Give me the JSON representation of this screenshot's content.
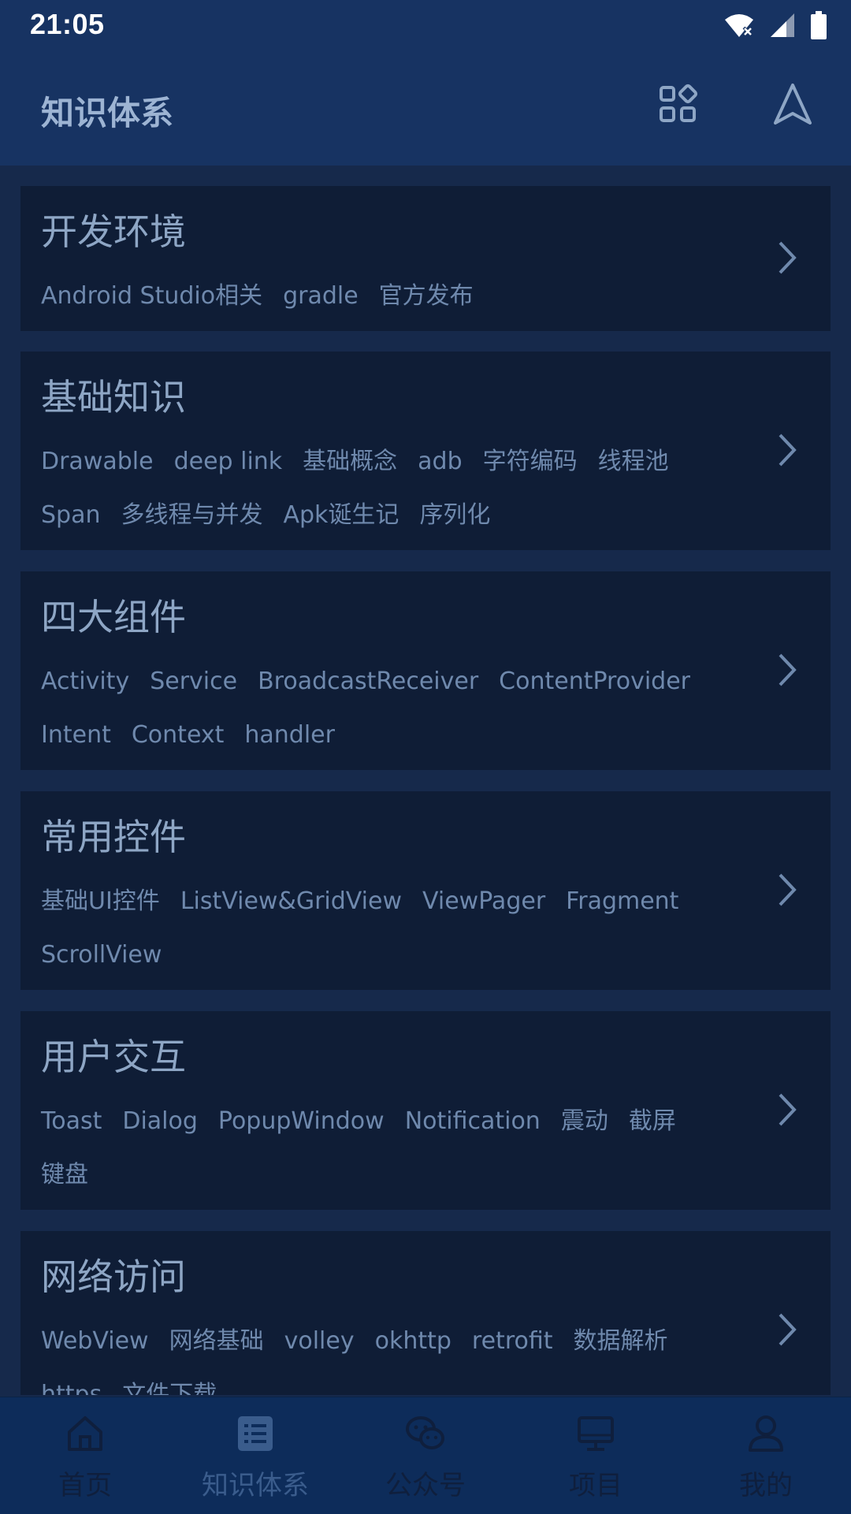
{
  "status": {
    "time": "21:05"
  },
  "appbar": {
    "title": "知识体系",
    "apps_icon": "apps-grid-icon",
    "navigate_icon": "navigation-arrow-icon"
  },
  "categories": [
    {
      "title": "开发环境",
      "tags": [
        "Android Studio相关",
        "gradle",
        "官方发布"
      ]
    },
    {
      "title": "基础知识",
      "tags": [
        "Drawable",
        "deep link",
        "基础概念",
        "adb",
        "字符编码",
        "线程池",
        "Span",
        "多线程与并发",
        "Apk诞生记",
        "序列化"
      ]
    },
    {
      "title": "四大组件",
      "tags": [
        "Activity",
        "Service",
        "BroadcastReceiver",
        "ContentProvider",
        "Intent",
        "Context",
        "handler"
      ]
    },
    {
      "title": "常用控件",
      "tags": [
        "基础UI控件",
        "ListView&GridView",
        "ViewPager",
        "Fragment",
        "ScrollView"
      ]
    },
    {
      "title": "用户交互",
      "tags": [
        "Toast",
        "Dialog",
        "PopupWindow",
        "Notification",
        "震动",
        "截屏",
        "键盘"
      ]
    },
    {
      "title": "网络访问",
      "tags": [
        "WebView",
        "网络基础",
        "volley",
        "okhttp",
        "retrofit",
        "数据解析",
        "https",
        "文件下载"
      ]
    }
  ],
  "bottom_nav": [
    {
      "label": "首页",
      "icon": "home-icon",
      "active": false
    },
    {
      "label": "知识体系",
      "icon": "list-icon",
      "active": true
    },
    {
      "label": "公众号",
      "icon": "wechat-icon",
      "active": false
    },
    {
      "label": "项目",
      "icon": "monitor-icon",
      "active": false
    },
    {
      "label": "我的",
      "icon": "person-icon",
      "active": false
    }
  ],
  "colors": {
    "appbar": "#173362",
    "background": "#16294b",
    "card": "#0f1d36",
    "bottom_nav": "#0d2c5a"
  }
}
